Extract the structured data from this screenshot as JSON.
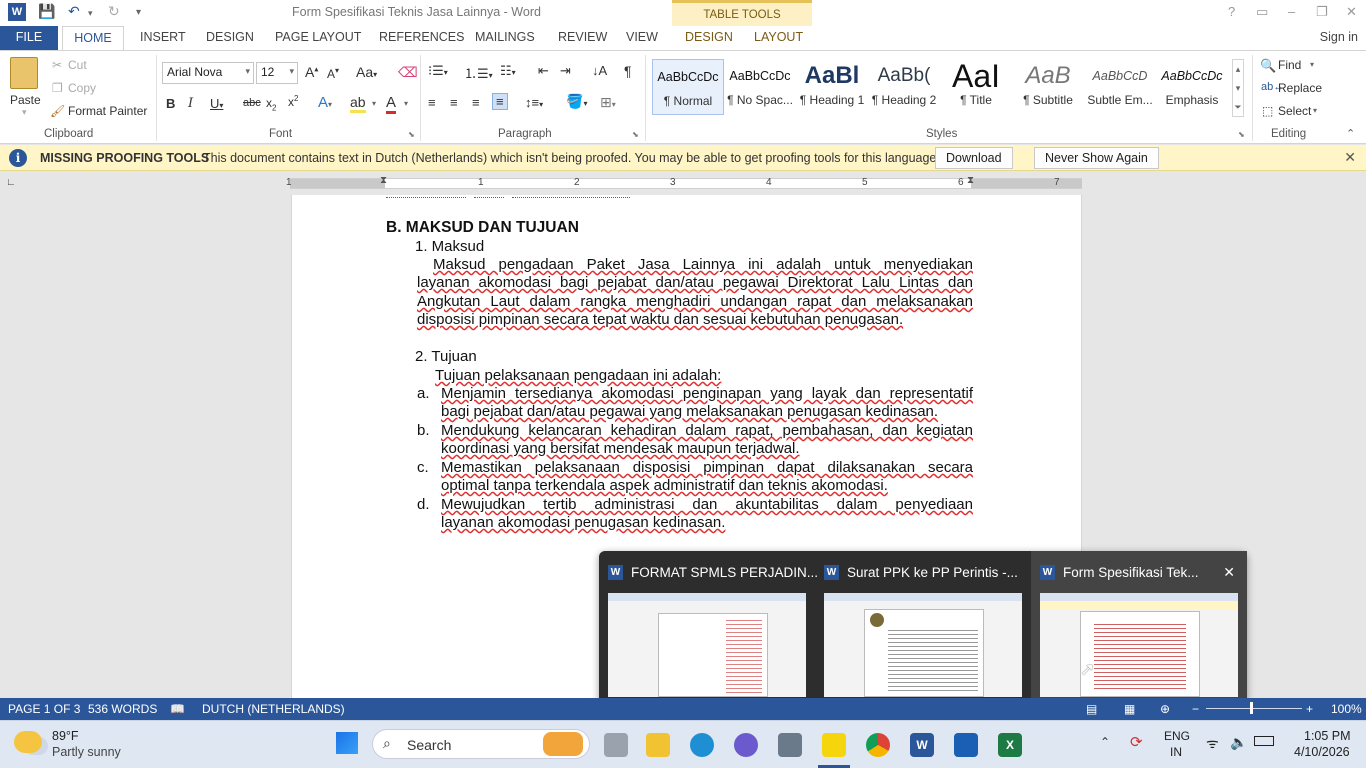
{
  "titlebar": {
    "title": "Form Spesifikasi Teknis Jasa Lainnya - Word",
    "context_group": "TABLE TOOLS",
    "help": "?",
    "minimize": "–",
    "restore": "❐",
    "close": "✕"
  },
  "ribbon_tabs": {
    "file": "FILE",
    "home": "HOME",
    "insert": "INSERT",
    "design": "DESIGN",
    "page_layout": "PAGE LAYOUT",
    "references": "REFERENCES",
    "mailings": "MAILINGS",
    "review": "REVIEW",
    "view": "VIEW",
    "table_design": "DESIGN",
    "table_layout": "LAYOUT",
    "sign_in": "Sign in"
  },
  "clipboard": {
    "paste": "Paste",
    "cut": "Cut",
    "copy": "Copy",
    "format_painter": "Format Painter",
    "label": "Clipboard"
  },
  "font": {
    "name": "Arial Nova",
    "size": "12",
    "label": "Font"
  },
  "paragraph": {
    "label": "Paragraph"
  },
  "styles": {
    "label": "Styles",
    "items": [
      {
        "preview": "AaBbCcDc",
        "name": "¶ Normal"
      },
      {
        "preview": "AaBbCcDc",
        "name": "¶ No Spac..."
      },
      {
        "preview": "AaBl",
        "name": "¶ Heading 1"
      },
      {
        "preview": "AaBb(",
        "name": "¶ Heading 2"
      },
      {
        "preview": "AaI",
        "name": "¶ Title"
      },
      {
        "preview": "AaB",
        "name": "¶ Subtitle"
      },
      {
        "preview": "AaBbCcD",
        "name": "Subtle Em..."
      },
      {
        "preview": "AaBbCcDc",
        "name": "Emphasis"
      }
    ]
  },
  "editing": {
    "find": "Find",
    "replace": "Replace",
    "select": "Select",
    "label": "Editing"
  },
  "infobar": {
    "heading": "MISSING PROOFING TOOLS",
    "message": "This document contains text in Dutch (Netherlands) which isn't being proofed. You may be able to get proofing tools for this language.",
    "download": "Download",
    "never_show": "Never Show Again"
  },
  "ruler": {
    "numbers": [
      "1",
      "1",
      "2",
      "3",
      "4",
      "5",
      "6",
      "7"
    ]
  },
  "document": {
    "heading": "B.  MAKSUD DAN TUJUAN",
    "sub1": "1.  Maksud",
    "para1": [
      "Maksud pengadaan Paket Jasa Lainnya ini adalah untuk menyediakan",
      "layanan akomodasi bagi pejabat dan/atau pegawai Direktorat Lalu Lintas dan",
      "Angkutan Laut dalam rangka menghadiri undangan rapat dan melaksanakan",
      "disposisi pimpinan secara tepat waktu dan sesuai kebutuhan penugasan."
    ],
    "sub2": "2.  Tujuan",
    "intro2": "Tujuan pelaksanaan pengadaan ini adalah:",
    "items": [
      {
        "letter": "a.",
        "lines": [
          "Menjamin tersedianya akomodasi penginapan yang layak dan representatif",
          "bagi pejabat dan/atau pegawai yang melaksanakan penugasan kedinasan."
        ]
      },
      {
        "letter": "b.",
        "lines": [
          "Mendukung kelancaran kehadiran dalam rapat, pembahasan, dan kegiatan",
          "koordinasi yang bersifat mendesak maupun terjadwal."
        ]
      },
      {
        "letter": "c.",
        "lines": [
          "Memastikan pelaksanaan disposisi pimpinan dapat dilaksanakan secara",
          "optimal tanpa terkendala aspek administratif dan teknis akomodasi."
        ]
      },
      {
        "letter": "d.",
        "lines": [
          "Mewujudkan tertib administrasi dan akuntabilitas dalam penyediaan",
          "layanan akomodasi penugasan kedinasan."
        ]
      }
    ]
  },
  "thumbnails": [
    {
      "title": "FORMAT SPMLS PERJADIN..."
    },
    {
      "title": "Surat PPK ke PP Perintis -..."
    },
    {
      "title": "Form Spesifikasi Tek..."
    }
  ],
  "statusbar": {
    "page": "PAGE 1 OF 3",
    "words": "536 WORDS",
    "language": "DUTCH (NETHERLANDS)",
    "zoom": "100%"
  },
  "taskbar": {
    "temperature": "89°F",
    "weather": "Partly sunny",
    "search": "Search",
    "lang1": "ENG",
    "lang2": "IN",
    "time": "1:05 PM",
    "date": "4/10/2026"
  },
  "colors": {
    "word_blue": "#2b579a",
    "infobar_bg": "#fff5c7",
    "table_tools": "#fdf0c4"
  }
}
